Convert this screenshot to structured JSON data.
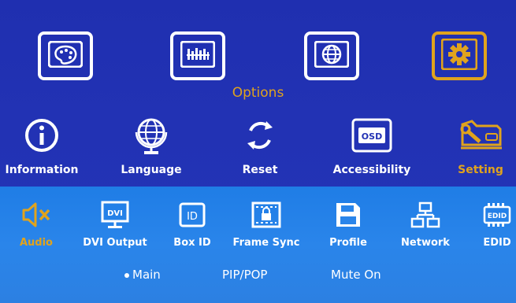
{
  "colors": {
    "background": "#2232b4",
    "panel": "#2a85ea",
    "accent": "#e0a31d",
    "text": "#ffffff"
  },
  "top_menu": [
    {
      "icon": "palette-icon",
      "selected": false
    },
    {
      "icon": "picture-adjust-icon",
      "selected": false
    },
    {
      "icon": "globe-grid-icon",
      "selected": false
    },
    {
      "icon": "gear-icon",
      "selected": true
    }
  ],
  "section_title": "Options",
  "options_menu": {
    "information": "Information",
    "language": "Language",
    "reset": "Reset",
    "accessibility": "Accessibility",
    "setting": "Setting"
  },
  "setting_menu": {
    "audio": "Audio",
    "dvi_output": "DVI Output",
    "box_id": "Box ID",
    "frame_sync": "Frame Sync",
    "profile": "Profile",
    "network": "Network",
    "edid": "EDID"
  },
  "icon_text": {
    "dvi": "DVI",
    "id": "ID",
    "osd": "OSD",
    "edid": "EDID"
  },
  "audio_options": {
    "main": "Main",
    "pip_pop": "PIP/POP",
    "mute_on": "Mute On"
  }
}
